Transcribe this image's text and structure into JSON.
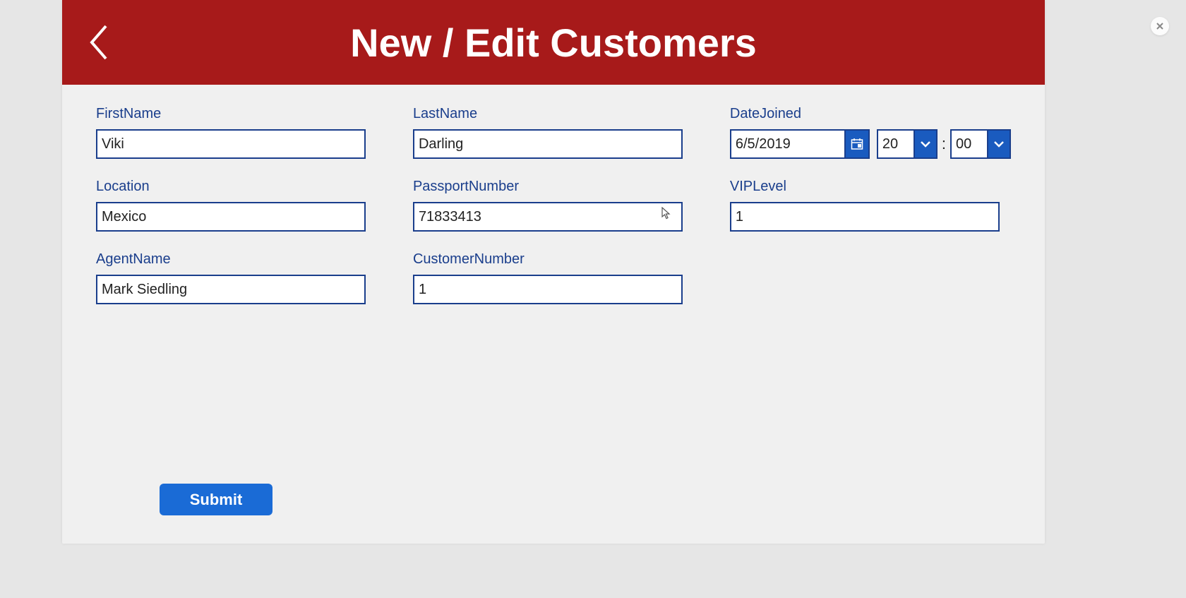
{
  "header": {
    "title": "New / Edit Customers"
  },
  "fields": {
    "firstName": {
      "label": "FirstName",
      "value": "Viki"
    },
    "lastName": {
      "label": "LastName",
      "value": "Darling"
    },
    "dateJoined": {
      "label": "DateJoined",
      "date": "6/5/2019",
      "hour": "20",
      "minute": "00",
      "separator": ":"
    },
    "location": {
      "label": "Location",
      "value": "Mexico"
    },
    "passportNumber": {
      "label": "PassportNumber",
      "value": "71833413"
    },
    "vipLevel": {
      "label": "VIPLevel",
      "value": "1"
    },
    "agentName": {
      "label": "AgentName",
      "value": "Mark Siedling"
    },
    "customerNumber": {
      "label": "CustomerNumber",
      "value": "1"
    }
  },
  "actions": {
    "submit": "Submit"
  },
  "colors": {
    "headerBg": "#a71a1a",
    "accentBlue": "#1a3e8c",
    "buttonBlue": "#1a6bd6",
    "controlBlue": "#1a5bbf"
  }
}
